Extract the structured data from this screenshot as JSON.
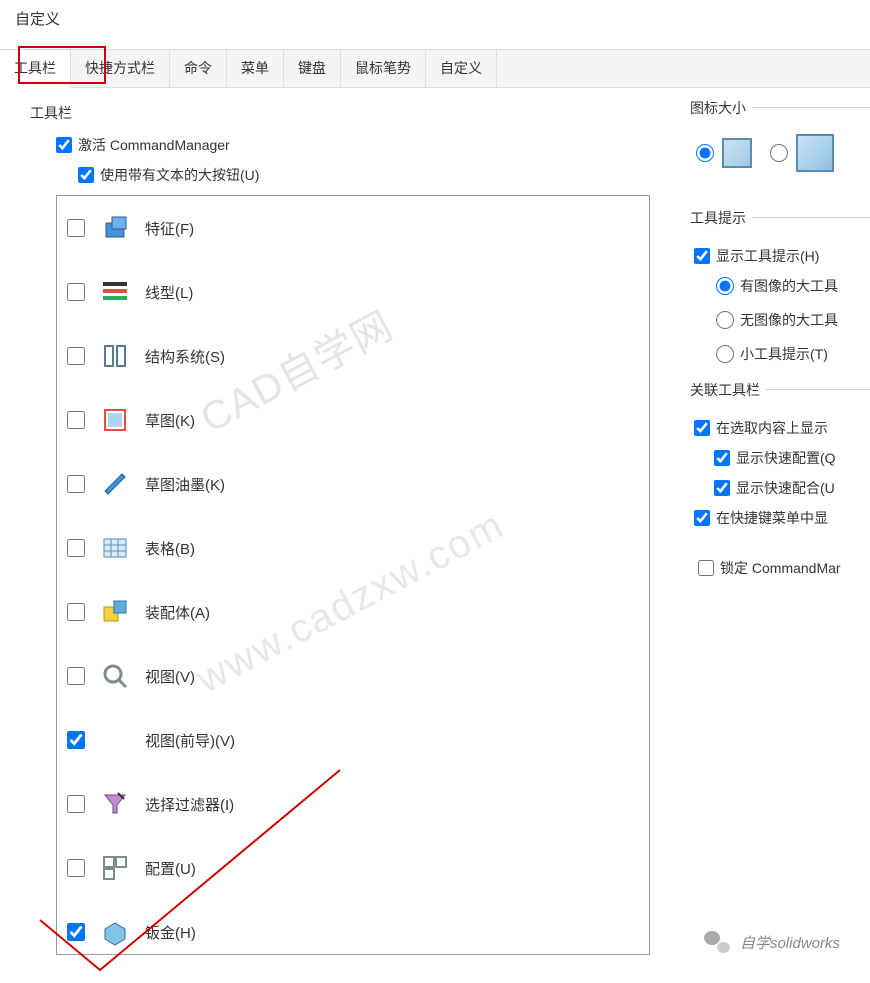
{
  "dialog": {
    "title": "自定义"
  },
  "tabs": [
    "工具栏",
    "快捷方式栏",
    "命令",
    "菜单",
    "键盘",
    "鼠标笔势",
    "自定义"
  ],
  "left": {
    "group_label": "工具栏",
    "activate_cm": "激活 CommandManager",
    "large_buttons": "使用带有文本的大按钮(U)",
    "items": [
      {
        "label": "特征(F)",
        "checked": false,
        "icon": "feature"
      },
      {
        "label": "线型(L)",
        "checked": false,
        "icon": "linetype"
      },
      {
        "label": "结构系统(S)",
        "checked": false,
        "icon": "structure"
      },
      {
        "label": "草图(K)",
        "checked": false,
        "icon": "sketch"
      },
      {
        "label": "草图油墨(K)",
        "checked": false,
        "icon": "ink"
      },
      {
        "label": "表格(B)",
        "checked": false,
        "icon": "table"
      },
      {
        "label": "装配体(A)",
        "checked": false,
        "icon": "assembly"
      },
      {
        "label": "视图(V)",
        "checked": false,
        "icon": "view"
      },
      {
        "label": "视图(前导)(V)",
        "checked": true,
        "icon": "blank"
      },
      {
        "label": "选择过滤器(I)",
        "checked": false,
        "icon": "filter"
      },
      {
        "label": "配置(U)",
        "checked": false,
        "icon": "config"
      },
      {
        "label": "钣金(H)",
        "checked": true,
        "icon": "sheetmetal"
      }
    ]
  },
  "right": {
    "icon_size_label": "图标大小",
    "tooltip_group": "工具提示",
    "show_tooltip": "显示工具提示(H)",
    "tooltip_opt1": "有图像的大工具",
    "tooltip_opt2": "无图像的大工具",
    "tooltip_opt3": "小工具提示(T)",
    "context_group": "关联工具栏",
    "ctx1": "在选取内容上显示",
    "ctx2": "显示快速配置(Q",
    "ctx3": "显示快速配合(U",
    "ctx4": "在快捷键菜单中显",
    "lock_cm": "锁定 CommandMar"
  },
  "watermark1": "CAD自学网",
  "watermark2": "www.cadzxw.com",
  "footer": "自学solidworks"
}
